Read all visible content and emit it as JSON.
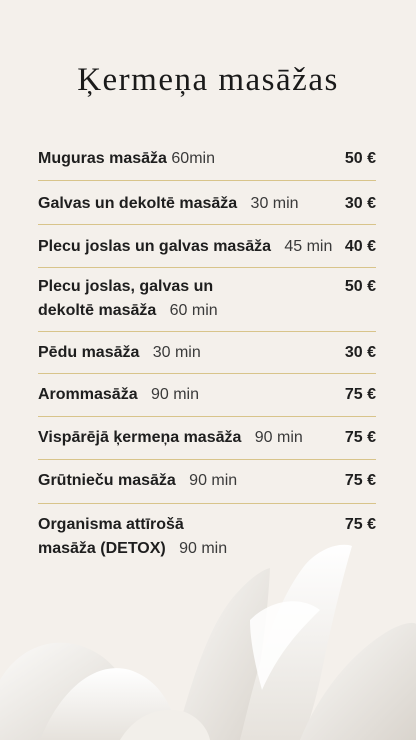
{
  "title": "Ķermeņa masāžas",
  "items": [
    {
      "name": "Muguras masāža",
      "duration": "60min",
      "price": "50 €"
    },
    {
      "name": "Galvas un dekoltē masāža",
      "duration": "30 min",
      "price": "30 €"
    },
    {
      "name": "Plecu joslas un galvas masāža",
      "duration": "45 min",
      "price": "40 €"
    },
    {
      "name_line1": "Plecu joslas, galvas un",
      "name_line2": "dekoltē masāža",
      "duration": "60 min",
      "price": "50 €"
    },
    {
      "name": "Pēdu masāža",
      "duration": "30 min",
      "price": "30 €"
    },
    {
      "name": "Arommasāža",
      "duration": "90 min",
      "price": "75 €"
    },
    {
      "name": "Vispārējā ķermeņa masāža",
      "duration": "90 min",
      "price": "75 €"
    },
    {
      "name": "Grūtnieču masāža",
      "duration": "90 min",
      "price": "75 €"
    },
    {
      "name_line1": "Organisma attīrošā",
      "name_line2": "masāža (DETOX)",
      "duration": "90 min",
      "price": "75 €"
    }
  ],
  "colors": {
    "background": "#f4f0eb",
    "divider": "#d8c48a",
    "text": "#1e1e1e"
  }
}
